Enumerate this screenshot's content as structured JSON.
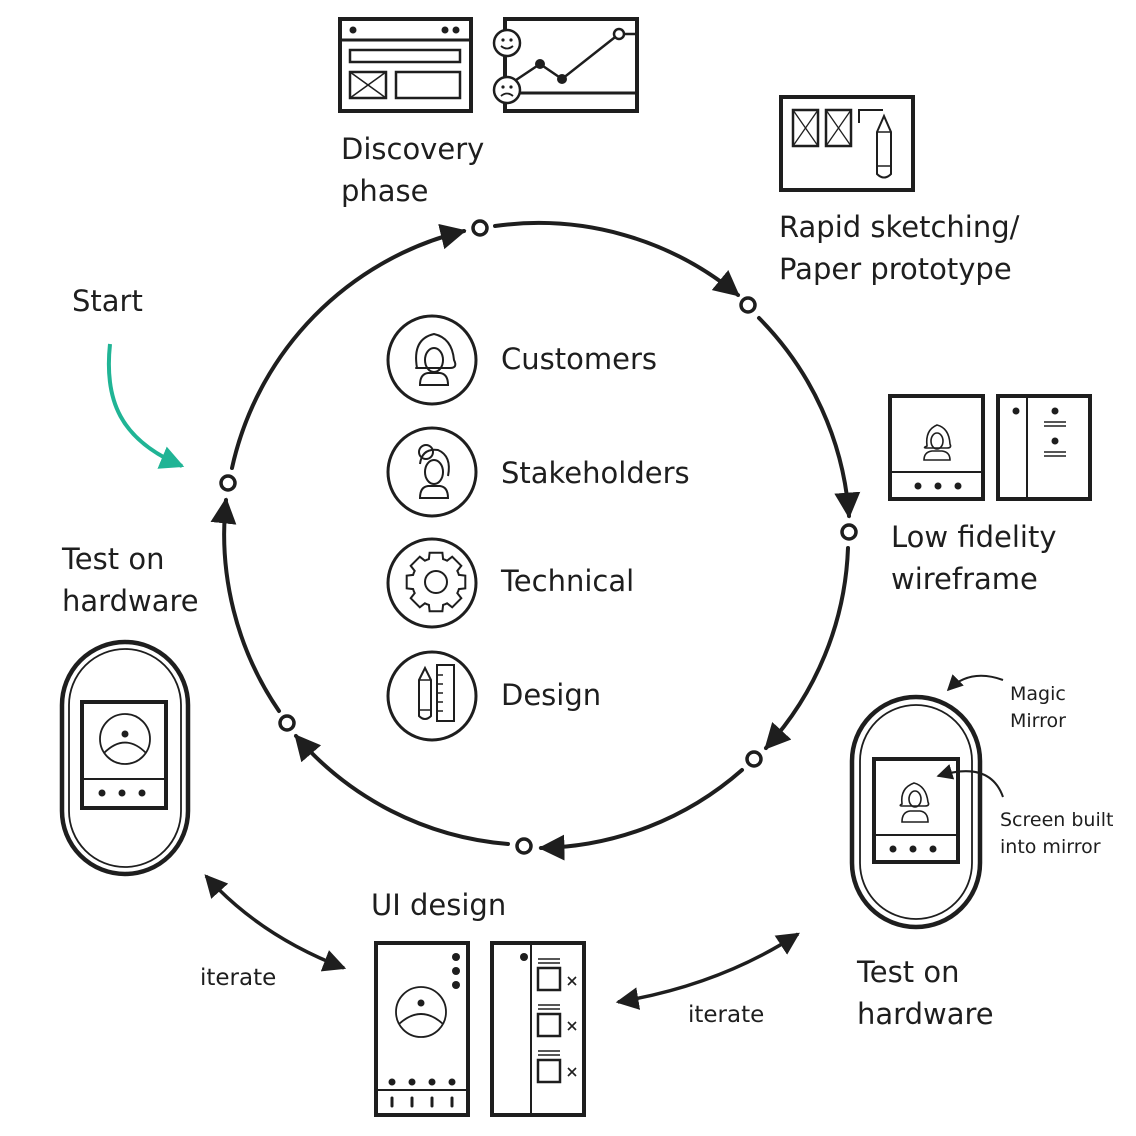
{
  "diagram": {
    "type": "iterative-design-cycle",
    "colors": {
      "ink": "#1e1e1e",
      "start_arrow": "#20b495",
      "background": "#ffffff"
    },
    "start_label": "Start",
    "stages": [
      {
        "id": "discovery",
        "label_lines": [
          "Discovery",
          "phase"
        ],
        "icon": "browser-wireframe-and-satisfaction-chart-icon"
      },
      {
        "id": "sketching",
        "label_lines": [
          "Rapid sketching/",
          "Paper prototype"
        ],
        "icon": "paper-sketch-with-pencil-icon"
      },
      {
        "id": "lowfi",
        "label_lines": [
          "Low fidelity",
          "wireframe"
        ],
        "icon": "low-fidelity-wireframe-screens-icon"
      },
      {
        "id": "test-right",
        "label_lines": [
          "Test on",
          "hardware"
        ],
        "icon": "magic-mirror-device-icon"
      },
      {
        "id": "ui-design",
        "label_lines": [
          "UI design"
        ],
        "icon": "ui-design-screens-icon"
      },
      {
        "id": "test-left",
        "label_lines": [
          "Test on",
          "hardware"
        ],
        "icon": "mirror-device-sad-face-icon"
      }
    ],
    "center_categories": [
      {
        "label": "Customers",
        "icon": "customer-person-icon"
      },
      {
        "label": "Stakeholders",
        "icon": "stakeholder-person-icon"
      },
      {
        "label": "Technical",
        "icon": "gear-icon"
      },
      {
        "label": "Design",
        "icon": "pencil-and-ruler-icon"
      }
    ],
    "annotations": {
      "magic_mirror_lines": [
        "Magic",
        "Mirror"
      ],
      "screen_built_lines": [
        "Screen built",
        "into mirror"
      ]
    },
    "iterate_labels": [
      "iterate",
      "iterate"
    ]
  }
}
